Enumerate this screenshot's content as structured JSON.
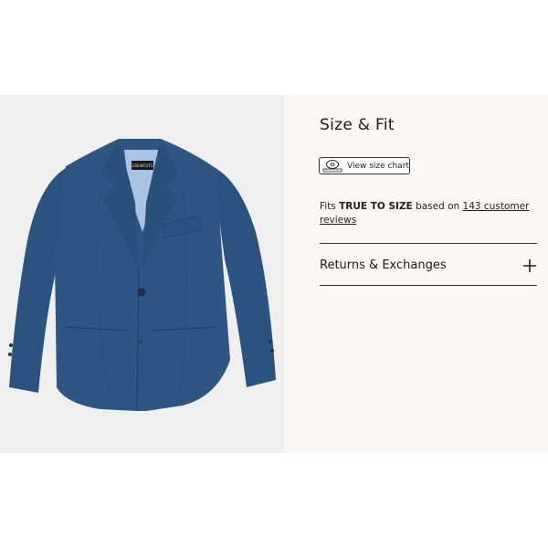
{
  "panel": {
    "title": "Size & Fit",
    "size_chart_button": {
      "label": "View size chart",
      "icon": "measuring-tape-icon"
    },
    "fit": {
      "prefix": "Fits",
      "emphasis": "TRUE TO SIZE",
      "middle": "based on",
      "reviews_link": "143 customer reviews"
    },
    "returns": {
      "label": "Returns & Exchanges",
      "icon": "plus-icon"
    }
  },
  "product_image": {
    "subject": "navy-blazer",
    "label_text": "CREWCUTS"
  },
  "colors": {
    "image_background": "#efefef",
    "panel_background": "#faf7f4",
    "blazer": "#2f5683",
    "text": "#1a1a1a"
  }
}
